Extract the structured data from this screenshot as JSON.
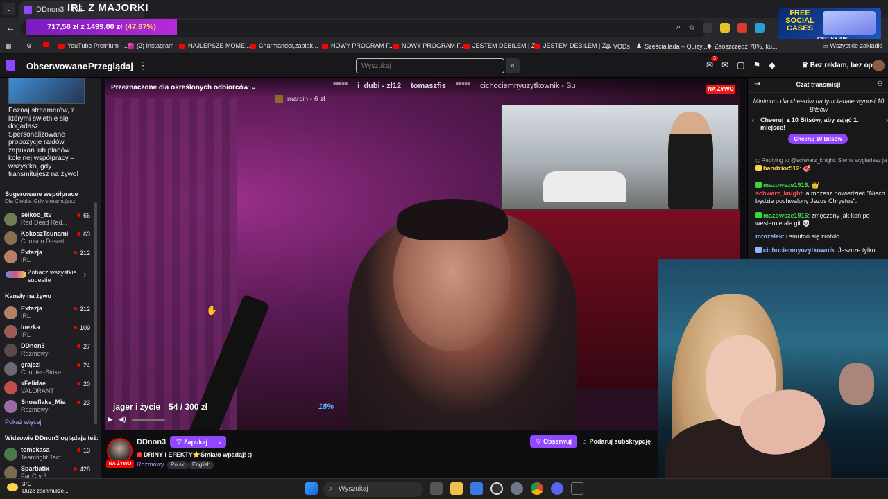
{
  "browser": {
    "tab_title": "DDnon3 - Twi",
    "overlay_title": "IRL Z MAJORKI",
    "goal_text": "717,58 zł z 1499,00 zł",
    "goal_pct": "(47.87%)",
    "promo_title": "FREE SOCIAL CASES",
    "promo_sub": "CSG SKINS",
    "bookmarks": [
      {
        "label": "YouTube Premium -...",
        "icon": "youtube-icon"
      },
      {
        "label": "(2) Instagram",
        "icon": "instagram-icon"
      },
      {
        "label": "NAJLEPSZE MOME...",
        "icon": "youtube-icon"
      },
      {
        "label": "Charmander,zabląk...",
        "icon": "youtube-icon"
      },
      {
        "label": "NOWY PROGRAM F...",
        "icon": "youtube-icon"
      },
      {
        "label": "NOWY PROGRAM F...",
        "icon": "youtube-icon"
      },
      {
        "label": "JESTEM DEBILEM | Z...",
        "icon": "youtube-icon"
      },
      {
        "label": "JESTEM DEBILEM | Z...",
        "icon": "youtube-icon"
      },
      {
        "label": "VODs",
        "icon": "globe-icon"
      },
      {
        "label": "Sześciallada – Quizy...",
        "icon": "quiz-icon"
      },
      {
        "label": "Zaoszczędź 70%, ku...",
        "icon": "steam-icon"
      }
    ],
    "bookmarks_folder": "Wszystkie zakładki"
  },
  "twitch_nav": {
    "following": "Obserwowane",
    "browse": "Przeglądaj",
    "search_placeholder": "Wyszukaj",
    "notif_count": "3",
    "no_ads": "Bez reklam, bez opłat"
  },
  "sidebar": {
    "promo_text": "Poznaj streamerów, z którymi świetnie się dogadasz. Spersonalizowane propozycje raidów, zapukań lub planów kolejnej współpracy – wszystko, gdy transmitujesz na żywo!",
    "suggested_title": "Sugerowane współprace",
    "suggested_sub": "Dla Ciebie. Gdy streamujesz.",
    "suggested": [
      {
        "name": "seikoo_ttv",
        "game": "Red Dead Red...",
        "viewers": "66",
        "color": "#6f7d55"
      },
      {
        "name": "KokoszTsunami",
        "game": "Crimson Desert",
        "viewers": "63",
        "color": "#8a6d52"
      },
      {
        "name": "Extazja",
        "game": "IRL",
        "viewers": "212",
        "color": "#b58066"
      }
    ],
    "show_all": "Zobacz wszystkie sugestie",
    "live_title": "Kanały na żywo",
    "live": [
      {
        "name": "Extazja",
        "game": "IRL",
        "viewers": "212",
        "color": "#b58066"
      },
      {
        "name": "Inezka",
        "game": "IRL",
        "viewers": "109",
        "color": "#a05a56"
      },
      {
        "name": "DDnon3",
        "game": "Rozmowy",
        "viewers": "27",
        "color": "#5a4a4a"
      },
      {
        "name": "grajczi",
        "game": "Counter-Strike",
        "viewers": "24",
        "color": "#6a6a70"
      },
      {
        "name": "xFelidae",
        "game": "VALORANT",
        "viewers": "20",
        "color": "#c0504a"
      },
      {
        "name": "Snowflake_Mia",
        "game": "Rozmowy",
        "viewers": "23",
        "color": "#9e6aa6"
      }
    ],
    "show_more": "Pokaż więcej",
    "watching_title": "Widzowie DDnon3 oglądają też:",
    "watching": [
      {
        "name": "tomekasa",
        "game": "Teamfight Tact...",
        "viewers": "13",
        "color": "#4a7a4a"
      },
      {
        "name": "Spartiatix",
        "game": "Far Cry 3",
        "viewers": "428",
        "color": "#7a6a50"
      }
    ]
  },
  "player": {
    "audience": "Przeznaczone dla określonych odbiorców",
    "ticker": [
      "i_dubi - zł12",
      "tomaszfis",
      "cichociemnyuzytkownik - Su"
    ],
    "donor": "marcin - 6 zł",
    "live_badge": "NA ŻYWO",
    "goal_label": "jager i życie",
    "goal_amount": "54 / 300 zł",
    "goal_pct": "18%"
  },
  "channel": {
    "name": "DDnon3",
    "invite": "Zapukaj",
    "title": "DRINY I EFEKTY Śmiało wpadaj! :)",
    "title_lead": "DRINY I EFEKTY",
    "title_star": "⭐",
    "title_rest": "Śmiało wpadaj! :)",
    "category": "Rozmowy",
    "tags": [
      "Polski",
      "English"
    ],
    "live_label": "NA ŻYWO",
    "follow": "Obserwuj",
    "subscribe": "Podaruj subskrypcję"
  },
  "chat": {
    "title": "Czat transmisji",
    "cheer_min": "Minimum dla cheerów na tym kanale wynosi 10 Bitsów",
    "cheer_text": "Cheeruj ▲10 Bitsów, aby zająć 1. miejsce!",
    "cheer_button": "Cheeruj 10 Bitsów",
    "reply": "Replying to @schwarz_knight: Siema wyglądasz ja",
    "messages": [
      {
        "user": "bandzior512",
        "text": "",
        "color": "#ffd24a",
        "emote": "🥩"
      },
      {
        "user": "mazowsze1916",
        "text": "",
        "color": "#3ed63e",
        "emote": "👑"
      },
      {
        "user": "schwarz_knight",
        "text": "a możesz powiedzieć \"Niech będzie pochwalony Jezus Chrystus\".",
        "color": "#ff4f4f",
        "emote": ""
      },
      {
        "user": "mazowsze1916",
        "text": "zmęczony jak koń po westernie ale git",
        "color": "#3ed63e",
        "emote": "💀"
      },
      {
        "user": "mrozelek",
        "text": "i smutno się zrobiło",
        "color": "#8fb8ff",
        "emote": ""
      },
      {
        "user": "cichociemnyuzytkownik",
        "text": "Jeszcze tylko",
        "color": "#8fb8ff",
        "emote": ""
      }
    ]
  },
  "taskbar": {
    "temp": "3°C",
    "weather": "Duże zachmurze...",
    "search": "Wyszukaj"
  }
}
